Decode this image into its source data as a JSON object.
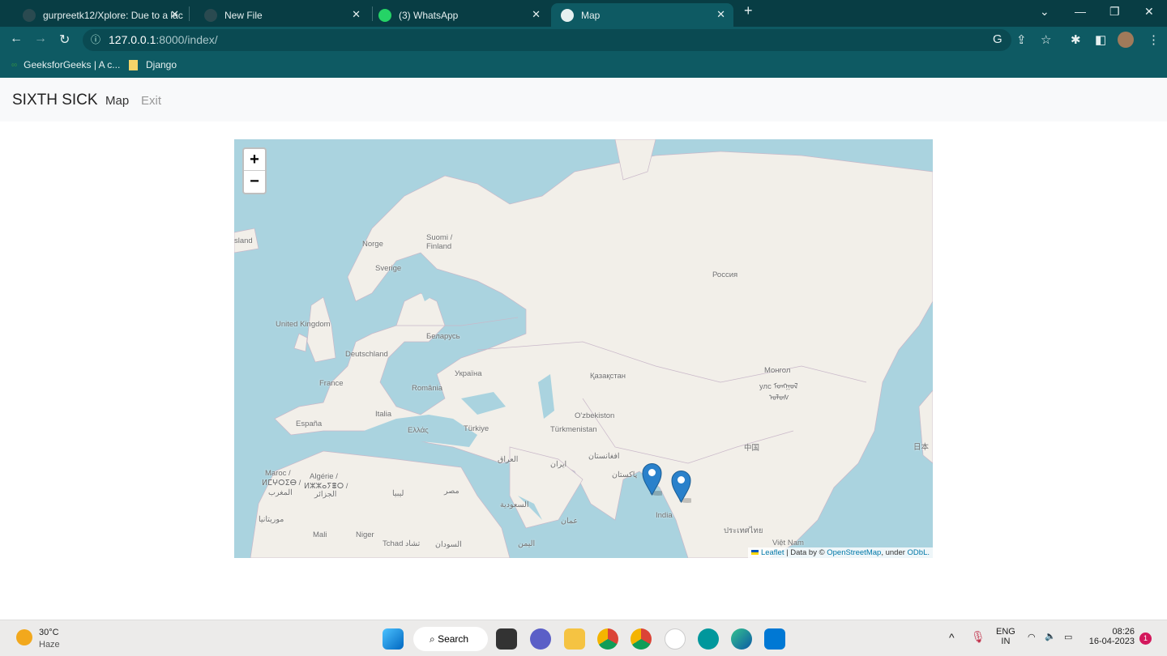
{
  "browser": {
    "tabs": [
      {
        "title": "gurpreetk12/Xplore: Due to a lac",
        "icon": "github-icon"
      },
      {
        "title": "New File",
        "icon": "github-icon"
      },
      {
        "title": "(3) WhatsApp",
        "icon": "whatsapp-icon"
      },
      {
        "title": "Map",
        "icon": "globe-icon",
        "active": true
      }
    ],
    "url_host": "127.0.0.1",
    "url_rest": ":8000/index/",
    "bookmarks": [
      {
        "label": "GeeksforGeeks | A c..."
      },
      {
        "label": "Django"
      }
    ]
  },
  "navbar": {
    "brand": "SIXTH SICK",
    "links": [
      {
        "label": "Map"
      },
      {
        "label": "Exit"
      }
    ]
  },
  "map": {
    "zoom_in": "+",
    "zoom_out": "−",
    "labels": [
      "sland",
      "Norge",
      "Suomi /",
      "Finland",
      "Sverige",
      "Россия",
      "United Kingdom",
      "Беларусь",
      "Deutschland",
      "Україна",
      "France",
      "România",
      "Қазақстан",
      "Монгол",
      "улс ᠮᠣᠩᠭᠣᠯ",
      "ᠤᠯᠤᠰ",
      "Italia",
      "España",
      "Ελλάς",
      "Türkiye",
      "O'zbekiston",
      "Türkmenistan",
      "中国",
      "日本",
      "Maroc /",
      "ⵍⵎⵖⵔⵉⴱ / ",
      "المغرب",
      "Algérie /",
      "ⵍⵣⵣⴰⵢⴻⵔ /",
      "الجزائر",
      "العراق",
      "ایران",
      "افغانستان",
      "پاکستان",
      "ليبيا",
      "مصر",
      "السعودية",
      "عمان",
      "India",
      "موريتانيا",
      "Mali",
      "Niger",
      "Tchad تشاد",
      "السودان",
      "اليمن",
      "Việt Nam",
      "ประเทศไทย"
    ],
    "attribution": {
      "leaflet": "Leaflet",
      "sep": " | Data by © ",
      "osm": "OpenStreetMap",
      "under": ", under ",
      "odbl": "ODbL."
    },
    "markers": [
      {
        "name": "marker-1"
      },
      {
        "name": "marker-2"
      }
    ],
    "colors": {
      "sea": "#aad3df",
      "land": "#f2efe9",
      "marker": "#2a81cb"
    }
  },
  "taskbar": {
    "weather_temp": "30°C",
    "weather_desc": "Haze",
    "search": "Search",
    "lang1": "ENG",
    "lang2": "IN",
    "time": "08:26",
    "date": "16-04-2023",
    "notif": "1"
  }
}
